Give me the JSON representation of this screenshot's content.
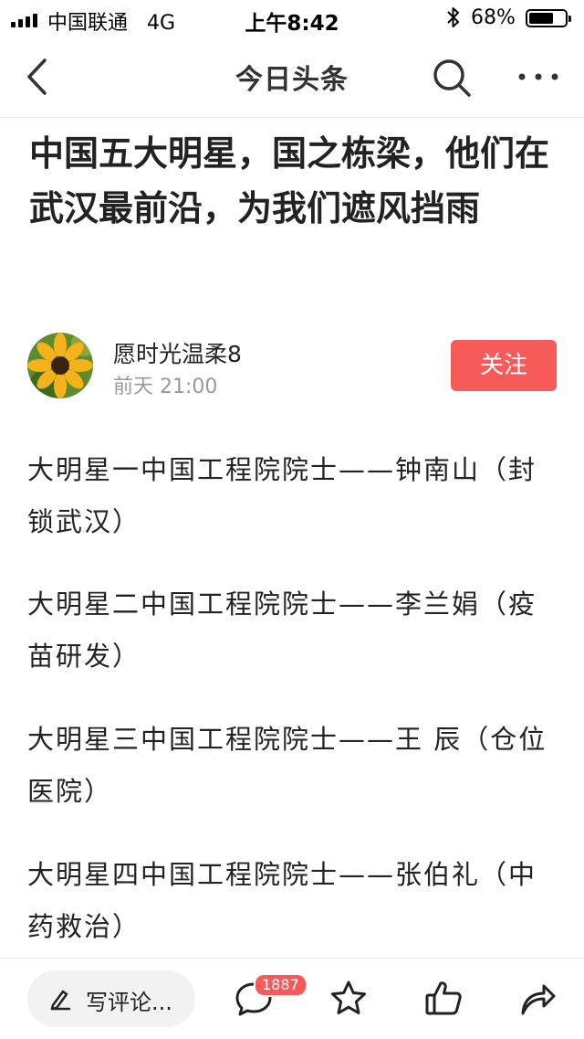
{
  "status_bar": {
    "carrier": "中国联通",
    "network": "4G",
    "time": "上午8:42",
    "battery_percent": "68%",
    "battery_level": 0.68
  },
  "nav": {
    "title": "今日头条",
    "back_icon": "chevron-left-icon",
    "search_icon": "search-icon",
    "more_icon": "more-dots-icon"
  },
  "article": {
    "title": "中国五大明星，国之栋梁，他们在武汉最前沿，为我们遮风挡雨",
    "author": {
      "name": "愿时光温柔8",
      "time": "前天 21:00",
      "follow_label": "关注"
    },
    "paragraphs": [
      "大明星一中国工程院院士——钟南山（封锁武汉）",
      "大明星二中国工程院院士——李兰娟（疫苗研发）",
      "大明星三中国工程院院士——王 辰（仓位医院）",
      "大明星四中国工程院院士——张伯礼（中药救治）"
    ]
  },
  "bottom_bar": {
    "comment_placeholder": "写评论...",
    "comment_count": "1887",
    "icons": [
      "pen-icon",
      "comment-icon",
      "star-icon",
      "thumbs-up-icon",
      "share-icon"
    ]
  },
  "colors": {
    "accent": "#f85959",
    "text": "#222222",
    "muted": "#999999"
  }
}
